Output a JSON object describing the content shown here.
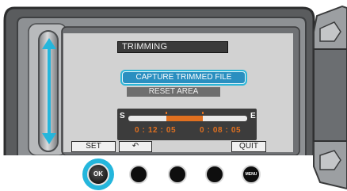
{
  "screen": {
    "title": "TRIMMING",
    "capture_label": "CAPTURE TRIMMED FILE",
    "reset_label": "RESET AREA"
  },
  "trim": {
    "start_label": "S",
    "end_label": "E",
    "start_time": "0 : 12 : 05",
    "end_time": "0 : 08 : 05"
  },
  "softkeys": {
    "set_label": "SET",
    "back_symbol": "↶",
    "quit_label": "QUIT"
  },
  "hardware": {
    "ok_label": "OK",
    "menu_label": "MENU"
  },
  "colors": {
    "highlight": "#24b6dc",
    "trim_range": "#e07020"
  }
}
